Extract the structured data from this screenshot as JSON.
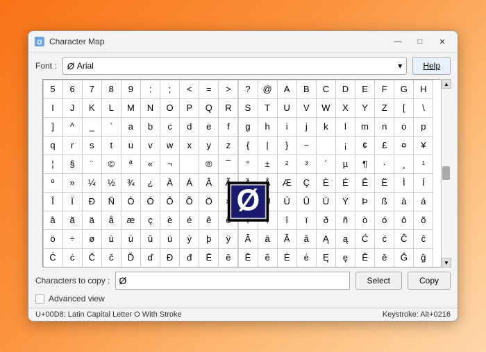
{
  "window": {
    "title": "Character Map",
    "icon": "🗺️"
  },
  "titlebar": {
    "minimize": "—",
    "maximize": "□",
    "close": "✕"
  },
  "toolbar": {
    "font_label": "Font :",
    "font_icon": "Ø",
    "font_value": "Arial",
    "help_label": "Help"
  },
  "chars": {
    "rows": [
      [
        "5",
        "6",
        "7",
        "8",
        "9",
        ":",
        ";",
        " <",
        " =",
        "  >",
        " ?",
        "@",
        "A",
        "B",
        "C",
        "D",
        "E",
        "F",
        "G",
        "H"
      ],
      [
        "I",
        "J",
        "K",
        "L",
        "M",
        "N",
        "O",
        "P",
        "Q",
        "R",
        "S",
        "T",
        "U",
        "V",
        "W",
        "X",
        "Y",
        "Z",
        "[",
        "\\"
      ],
      [
        "]",
        "^",
        "_",
        "`",
        "a",
        "b",
        "c",
        "d",
        "e",
        "f",
        "g",
        "h",
        "i",
        "j",
        "k",
        "l",
        "m",
        "n",
        "o",
        "p"
      ],
      [
        "q",
        "r",
        "s",
        "t",
        "u",
        "v",
        "w",
        "x",
        "y",
        "z",
        "{",
        "|",
        "}",
        "~",
        " ",
        "¡",
        "¢",
        "£",
        "¤",
        "¥"
      ],
      [
        "¦",
        "§",
        "¨",
        "©",
        "ª",
        "«",
        "¬",
        "­",
        "®",
        "¯",
        "°",
        "±",
        "²",
        "³",
        "´",
        "µ",
        "¶",
        "·",
        "¸",
        "¹"
      ],
      [
        "º",
        "»",
        "¼",
        "½",
        "¾",
        "¿",
        "À",
        "Á",
        "Â",
        "Ã",
        "Ä",
        "Å",
        "Æ",
        "Ç",
        "È",
        "É",
        "Ê",
        "Ë",
        "Ì",
        "Í"
      ],
      [
        "Î",
        "Ï",
        "Ð",
        "Ñ",
        "Ò",
        "Ó",
        "Ô",
        "Õ",
        "Ö",
        "×",
        "Ø",
        "Ù",
        "Ú",
        "Û",
        "Ü",
        "Ý",
        "Þ",
        "ß",
        "à",
        "á"
      ],
      [
        "â",
        "ã",
        "ä",
        "å",
        "æ",
        "ç",
        "è",
        "é",
        "ê",
        "ë",
        "ì",
        "í",
        "î",
        "ï",
        "ð",
        "ñ",
        "ò",
        "ó",
        "ô",
        "õ"
      ],
      [
        "ö",
        "÷",
        "ø",
        "ù",
        "ú",
        "û",
        "ü",
        "ý",
        "þ",
        "ÿ",
        "Ā",
        "ā",
        "Ă",
        "ă",
        "Ą",
        "ą",
        "Ć",
        "ć",
        "Ĉ",
        "ĉ"
      ],
      [
        "Ċ",
        "ċ",
        "Č",
        "č",
        "Ď",
        "ď",
        "Đ",
        "đ",
        "Ē",
        "ē",
        "Ĕ",
        "ĕ",
        "Ė",
        "ė",
        "Ę",
        "ę",
        "Ě",
        "ě",
        "Ĝ",
        "ĝ"
      ]
    ],
    "selected_char": "Ø",
    "selected_row": 6,
    "selected_col": 10
  },
  "bottom": {
    "chars_to_copy_label": "Characters to copy :",
    "chars_to_copy_value": "Ø",
    "select_label": "Select",
    "copy_label": "Copy",
    "advanced_view_label": "Advanced view"
  },
  "status": {
    "char_info": "U+00D8: Latin Capital Letter O With Stroke",
    "keystroke": "Keystroke: Alt+0216"
  }
}
